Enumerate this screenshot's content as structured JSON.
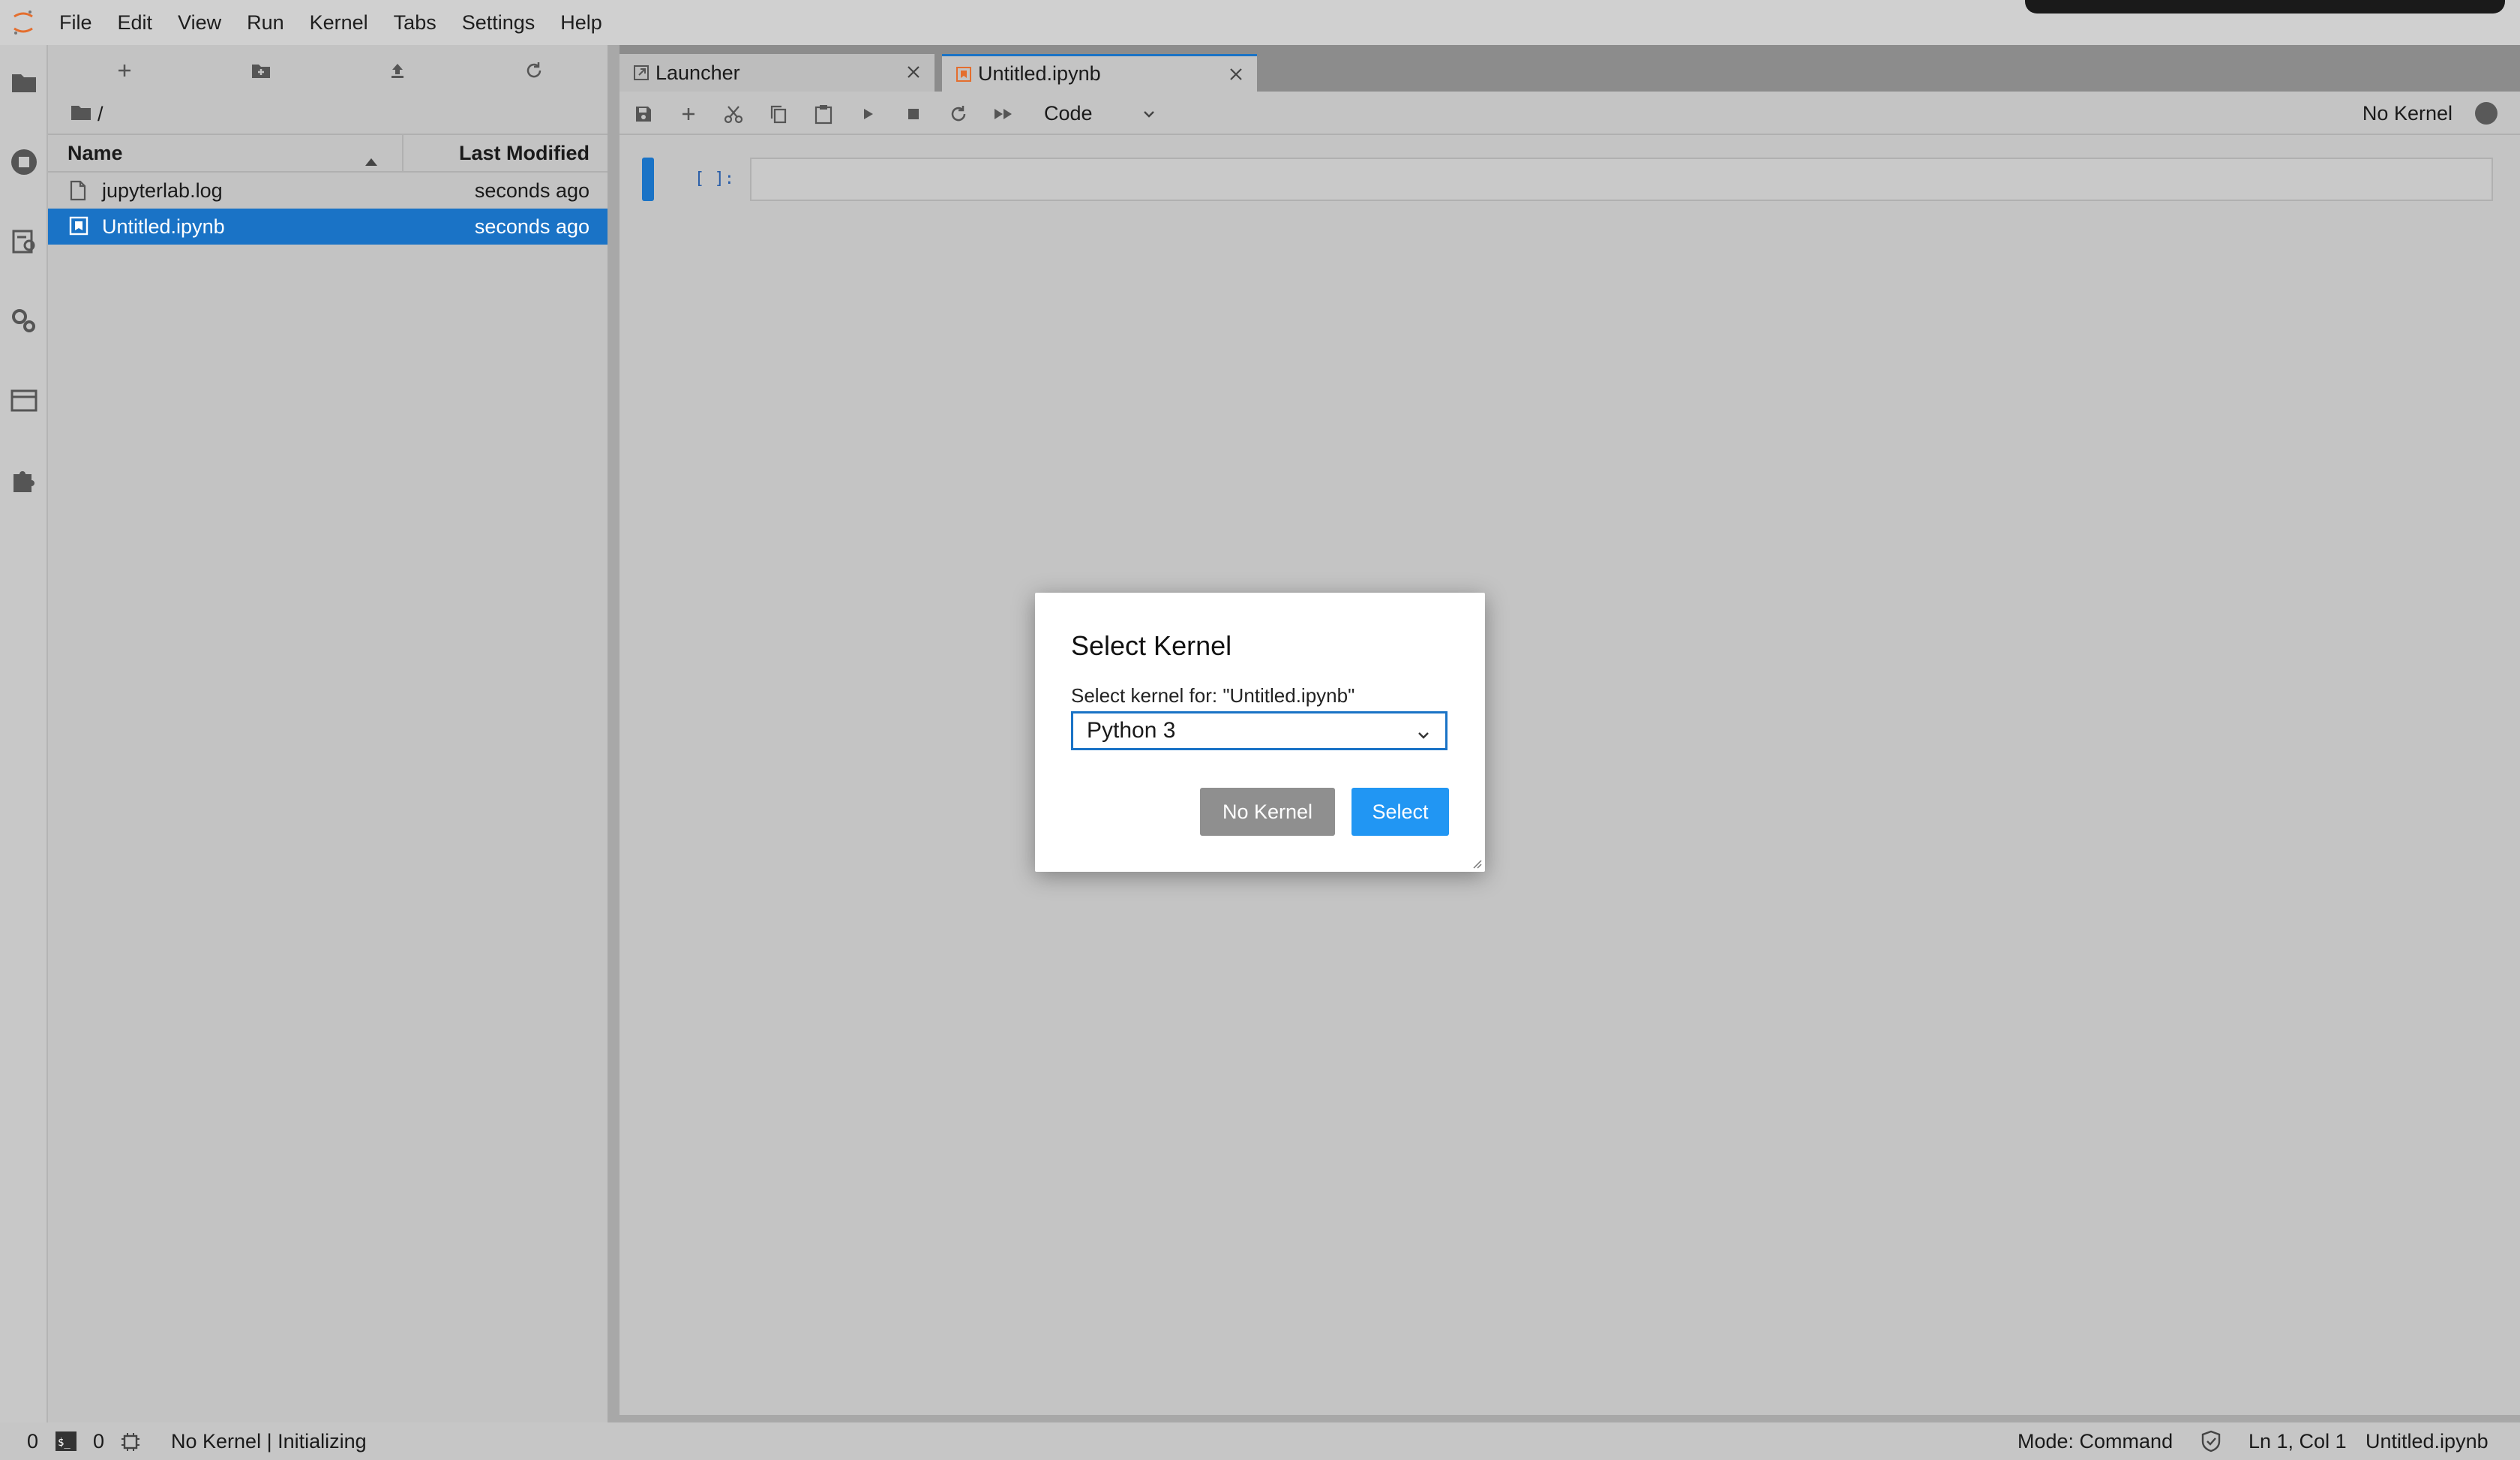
{
  "menubar": {
    "items": [
      "File",
      "Edit",
      "View",
      "Run",
      "Kernel",
      "Tabs",
      "Settings",
      "Help"
    ]
  },
  "activitybar": {
    "icons": [
      "folder-icon",
      "running-icon",
      "commands-icon",
      "property-inspector-icon",
      "tabs-icon",
      "extension-icon"
    ]
  },
  "filebrowser": {
    "path": "/",
    "columns": {
      "name": "Name",
      "modified": "Last Modified"
    },
    "files": [
      {
        "name": "jupyterlab.log",
        "modified": "seconds ago",
        "icon": "file-icon",
        "selected": false
      },
      {
        "name": "Untitled.ipynb",
        "modified": "seconds ago",
        "icon": "notebook-icon",
        "selected": true
      }
    ]
  },
  "tabs": [
    {
      "label": "Launcher",
      "icon": "launcher-icon",
      "active": false
    },
    {
      "label": "Untitled.ipynb",
      "icon": "notebook-icon",
      "active": true
    }
  ],
  "notebook": {
    "cell_type": "Code",
    "kernel_name": "No Kernel",
    "cell_prompt": "[ ]:"
  },
  "dialog": {
    "title": "Select Kernel",
    "label": "Select kernel for: \"Untitled.ipynb\"",
    "selected_kernel": "Python 3",
    "no_kernel_button": "No Kernel",
    "select_button": "Select"
  },
  "statusbar": {
    "terminals_count": "0",
    "kernels_count": "0",
    "kernel_status": "No Kernel | Initializing",
    "mode": "Mode: Command",
    "cursor": "Ln 1, Col 1",
    "filename": "Untitled.ipynb"
  },
  "colors": {
    "accent": "#1a73c6",
    "select_button": "#2196f3",
    "no_kernel_button": "#8f8f8f"
  }
}
